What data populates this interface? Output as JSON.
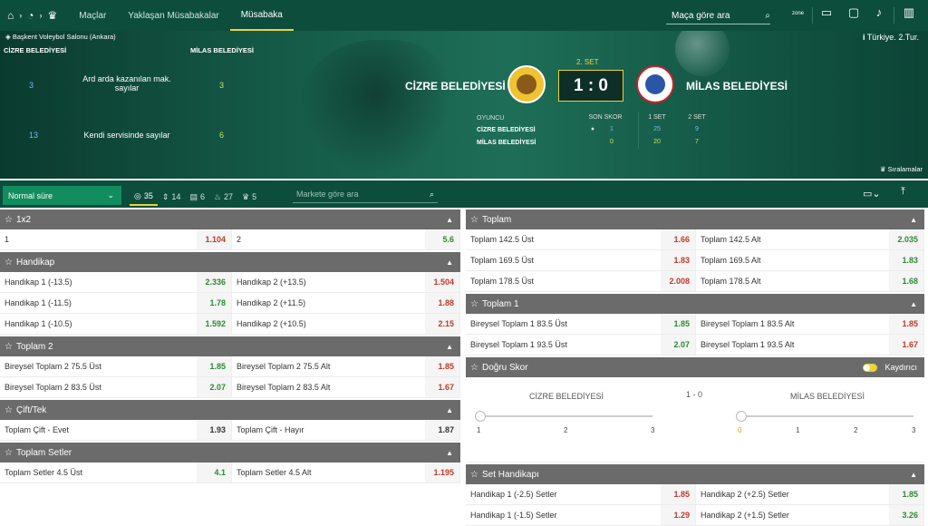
{
  "nav": {
    "items": [
      {
        "label": "Maçlar",
        "active": false
      },
      {
        "label": "Yaklaşan Müsabakalar",
        "active": false
      },
      {
        "label": "Müsabaka",
        "active": true
      }
    ],
    "search_placeholder": "Maça göre ara",
    "zone_label": "zone"
  },
  "match": {
    "venue": "Başkent Voleybol Salonu (Ankara)",
    "league": "Türkiye. 2.Tur.",
    "team1": "CİZRE BELEDİYESİ",
    "team2": "MİLAS BELEDİYESİ",
    "set_label": "2. SET",
    "score": "1 : 0",
    "stats": [
      {
        "label": "Ard arda kazanılan mak. sayılar",
        "t1": "3",
        "t2": "3"
      },
      {
        "label": "Kendi servisinde sayılar",
        "t1": "13",
        "t2": "6"
      }
    ],
    "scoreboard": {
      "headers": {
        "player": "OYUNCU",
        "score": "SON SKOR",
        "set1": "1 SET",
        "set2": "2 SET"
      },
      "rows": [
        {
          "team": "CİZRE BELEDİYESİ",
          "score": "1",
          "set1": "25",
          "set2": "9"
        },
        {
          "team": "MİLAS BELEDİYESİ",
          "score": "0",
          "set1": "20",
          "set2": "7"
        }
      ]
    },
    "standings_label": "Sıralamalar"
  },
  "filters": {
    "period": "Normal süre",
    "tabs": [
      {
        "icon": "target-icon",
        "count": "35",
        "active": true
      },
      {
        "icon": "sort-icon",
        "count": "14",
        "active": false
      },
      {
        "icon": "bars-icon",
        "count": "6",
        "active": false
      },
      {
        "icon": "fire-icon",
        "count": "27",
        "active": false
      },
      {
        "icon": "trophy-icon",
        "count": "5",
        "active": false
      }
    ],
    "market_search_placeholder": "Markete göre ara"
  },
  "left_markets": [
    {
      "title": "1x2",
      "rows": [
        [
          {
            "name": "1",
            "odd": "1.104",
            "trend": "dn"
          },
          {
            "name": "2",
            "odd": "5.6",
            "trend": "up"
          }
        ]
      ]
    },
    {
      "title": "Handikap",
      "rows": [
        [
          {
            "name": "Handikap 1 (-13.5)",
            "odd": "2.336",
            "trend": "up"
          },
          {
            "name": "Handikap 2 (+13.5)",
            "odd": "1.504",
            "trend": "dn"
          }
        ],
        [
          {
            "name": "Handikap 1 (-11.5)",
            "odd": "1.78",
            "trend": "up"
          },
          {
            "name": "Handikap 2 (+11.5)",
            "odd": "1.88",
            "trend": "dn"
          }
        ],
        [
          {
            "name": "Handikap 1 (-10.5)",
            "odd": "1.592",
            "trend": "up"
          },
          {
            "name": "Handikap 2 (+10.5)",
            "odd": "2.15",
            "trend": "dn"
          }
        ]
      ]
    },
    {
      "title": "Toplam 2",
      "rows": [
        [
          {
            "name": "Bireysel Toplam 2 75.5 Üst",
            "odd": "1.85",
            "trend": "up"
          },
          {
            "name": "Bireysel Toplam 2 75.5 Alt",
            "odd": "1.85",
            "trend": "dn"
          }
        ],
        [
          {
            "name": "Bireysel Toplam 2 83.5 Üst",
            "odd": "2.07",
            "trend": "up"
          },
          {
            "name": "Bireysel Toplam 2 83.5 Alt",
            "odd": "1.67",
            "trend": "dn"
          }
        ]
      ]
    },
    {
      "title": "Çift/Tek",
      "rows": [
        [
          {
            "name": "Toplam Çift - Evet",
            "odd": "1.93",
            "trend": ""
          },
          {
            "name": "Toplam Çift - Hayır",
            "odd": "1.87",
            "trend": ""
          }
        ]
      ]
    },
    {
      "title": "Toplam Setler",
      "rows": [
        [
          {
            "name": "Toplam Setler 4.5 Üst",
            "odd": "4.1",
            "trend": "up"
          },
          {
            "name": "Toplam Setler 4.5 Alt",
            "odd": "1.195",
            "trend": "dn"
          }
        ]
      ]
    }
  ],
  "right_markets": [
    {
      "title": "Toplam",
      "rows": [
        [
          {
            "name": "Toplam 142.5 Üst",
            "odd": "1.66",
            "trend": "dn"
          },
          {
            "name": "Toplam 142.5 Alt",
            "odd": "2.035",
            "trend": "up"
          }
        ],
        [
          {
            "name": "Toplam 169.5 Üst",
            "odd": "1.83",
            "trend": "dn"
          },
          {
            "name": "Toplam 169.5 Alt",
            "odd": "1.83",
            "trend": "up"
          }
        ],
        [
          {
            "name": "Toplam 178.5 Üst",
            "odd": "2.008",
            "trend": "dn"
          },
          {
            "name": "Toplam 178.5 Alt",
            "odd": "1.68",
            "trend": "up"
          }
        ]
      ]
    },
    {
      "title": "Toplam 1",
      "rows": [
        [
          {
            "name": "Bireysel Toplam 1 83.5 Üst",
            "odd": "1.85",
            "trend": "up"
          },
          {
            "name": "Bireysel Toplam 1 83.5 Alt",
            "odd": "1.85",
            "trend": "dn"
          }
        ],
        [
          {
            "name": "Bireysel Toplam 1 93.5 Üst",
            "odd": "2.07",
            "trend": "up"
          },
          {
            "name": "Bireysel Toplam 1 93.5 Alt",
            "odd": "1.67",
            "trend": "dn"
          }
        ]
      ]
    }
  ],
  "correct_score": {
    "title": "Doğru Skor",
    "slider_label": "Kaydırıcı",
    "team1": "CİZRE BELEDİYESİ",
    "team2": "MİLAS BELEDİYESİ",
    "score": "1 - 0",
    "ticks1": [
      "1",
      "2",
      "3"
    ],
    "ticks2": [
      "0",
      "1",
      "2",
      "3"
    ]
  },
  "set_handicap": {
    "title": "Set Handikapı",
    "rows": [
      [
        {
          "name": "Handikap 1 (-2.5) Setler",
          "odd": "1.85",
          "trend": "dn"
        },
        {
          "name": "Handikap 2 (+2.5) Setler",
          "odd": "1.85",
          "trend": "up"
        }
      ],
      [
        {
          "name": "Handikap 1 (-1.5) Setler",
          "odd": "1.29",
          "trend": "dn"
        },
        {
          "name": "Handikap 2 (+1.5) Setler",
          "odd": "3.26",
          "trend": "up"
        }
      ]
    ]
  }
}
